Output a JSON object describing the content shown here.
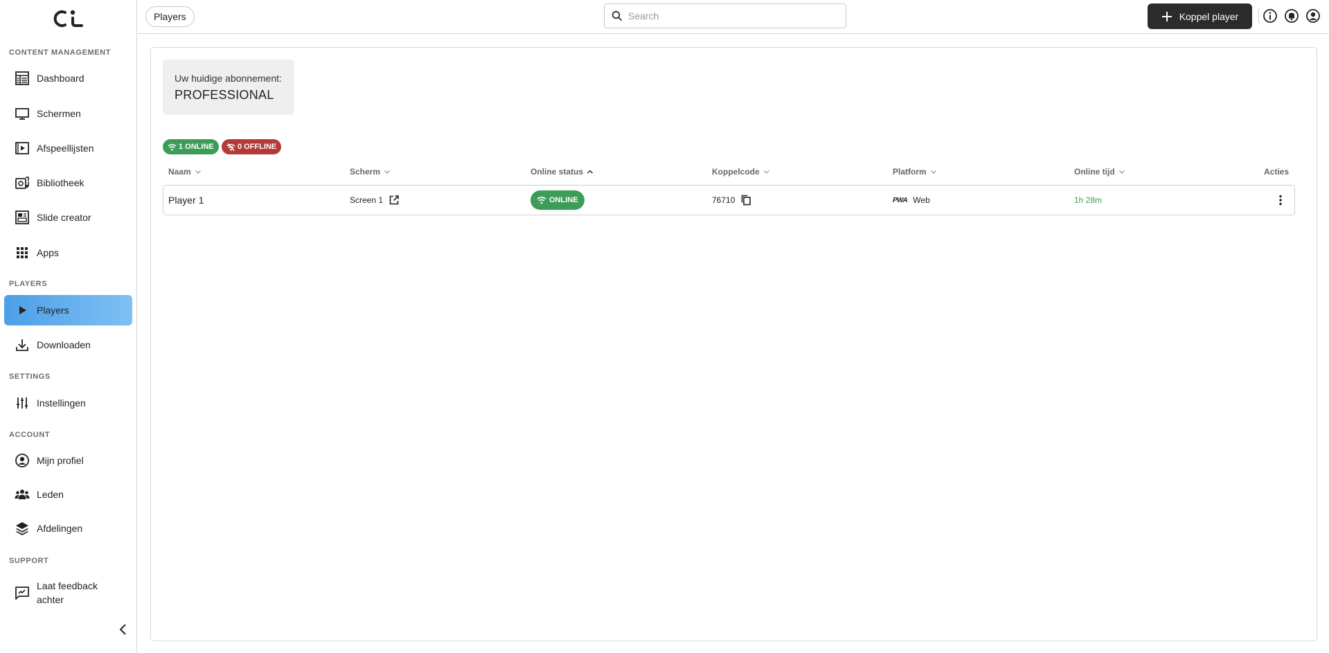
{
  "sidebar": {
    "sections": {
      "content": "CONTENT MANAGEMENT",
      "players": "PLAYERS",
      "settings": "SETTINGS",
      "account": "ACCOUNT",
      "support": "SUPPORT"
    },
    "items": {
      "dashboard": "Dashboard",
      "schermen": "Schermen",
      "afspeellijsten": "Afspeellijsten",
      "bibliotheek": "Bibliotheek",
      "slide_creator": "Slide creator",
      "apps": "Apps",
      "players": "Players",
      "downloaden": "Downloaden",
      "instellingen": "Instellingen",
      "mijn_profiel": "Mijn profiel",
      "leden": "Leden",
      "afdelingen": "Afdelingen",
      "feedback_line1": "Laat feedback",
      "feedback_line2": "achter"
    },
    "active_item": "players",
    "accent_color": "#63aff0"
  },
  "header": {
    "breadcrumb": "Players",
    "search_placeholder": "Search",
    "search_value": "",
    "primary_button": "Koppel player",
    "icons": [
      "info-icon",
      "notification-bell-icon",
      "account-icon"
    ]
  },
  "subscription": {
    "label": "Uw huidige abonnement:",
    "plan": "PROFESSIONAL"
  },
  "badges": {
    "online": "1 ONLINE",
    "offline": "0 OFFLINE",
    "online_color": "#3c9d58",
    "offline_color": "#b43a3a"
  },
  "table": {
    "columns": {
      "naam": "Naam",
      "scherm": "Scherm",
      "online_status": "Online status",
      "koppelcode": "Koppelcode",
      "platform": "Platform",
      "online_tijd": "Online tijd",
      "acties": "Acties"
    },
    "sorted_column": "online_status",
    "rows": [
      {
        "naam": "Player 1",
        "scherm": "Screen 1",
        "status": "ONLINE",
        "koppelcode": "76710",
        "platform_logo": "PWA",
        "platform": "Web",
        "online_tijd": "1h 28m"
      }
    ]
  }
}
